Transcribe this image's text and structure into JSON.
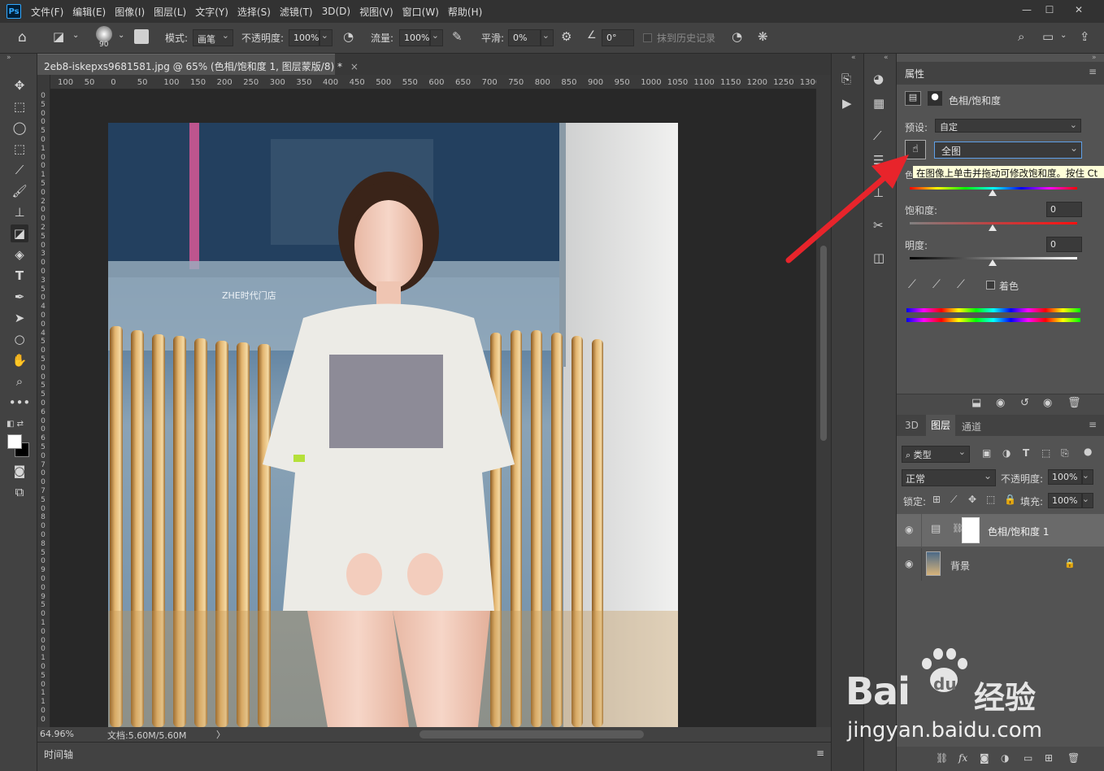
{
  "menubar": {
    "logo": "Ps",
    "items": [
      "文件(F)",
      "编辑(E)",
      "图像(I)",
      "图层(L)",
      "文字(Y)",
      "选择(S)",
      "滤镜(T)",
      "3D(D)",
      "视图(V)",
      "窗口(W)",
      "帮助(H)"
    ],
    "window_controls": [
      "—",
      "☐",
      "✕"
    ]
  },
  "options_bar": {
    "brush_size": "90",
    "mode_label": "模式:",
    "mode_value": "画笔",
    "opacity_label": "不透明度:",
    "opacity_value": "100%",
    "flow_label": "流量:",
    "flow_value": "100%",
    "smooth_label": "平滑:",
    "smooth_value": "0%",
    "angle_value": "0°",
    "erase_history_label": "抹到历史记录"
  },
  "document": {
    "tab_title": "2eb8-iskepxs9681581.jpg @ 65% (色相/饱和度 1, 图层蒙版/8) *",
    "close_glyph": "×",
    "ruler_h": [
      "100",
      "50",
      "0",
      "50",
      "100",
      "150",
      "200",
      "250",
      "300",
      "350",
      "400",
      "450",
      "500",
      "550",
      "600",
      "650",
      "700",
      "750",
      "800",
      "850",
      "900",
      "950",
      "1000",
      "1050",
      "1100",
      "1150",
      "1200",
      "1250",
      "1300"
    ],
    "ruler_v": [
      "0",
      "5",
      "0",
      "0",
      "5",
      "0",
      "1",
      "0",
      "0",
      "1",
      "5",
      "0",
      "2",
      "0",
      "0",
      "2",
      "5",
      "0",
      "3",
      "0",
      "0",
      "3",
      "5",
      "0",
      "4",
      "0",
      "0",
      "4",
      "5",
      "0",
      "5",
      "0",
      "0",
      "5",
      "5",
      "0",
      "6",
      "0",
      "0",
      "6",
      "5",
      "0",
      "7",
      "0",
      "0",
      "7",
      "5",
      "0",
      "8",
      "0",
      "0",
      "8",
      "5",
      "0",
      "9",
      "0",
      "0",
      "9",
      "5",
      "0",
      "1",
      "0",
      "0",
      "0",
      "1",
      "0",
      "5",
      "0",
      "1",
      "1",
      "0",
      "0"
    ],
    "photo_text": "ZHE时代门店"
  },
  "status": {
    "zoom": "64.96%",
    "doc_size": "文档:5.60M/5.60M",
    "arrow": "〉"
  },
  "timeline": {
    "label": "时间轴"
  },
  "properties": {
    "title": "属性",
    "adjustment_name": "色相/饱和度",
    "preset_label": "预设:",
    "preset_value": "自定",
    "range_value": "全图",
    "tooltip": "在图像上单击并拖动可修改饱和度。按住 Ct",
    "hue_label_partial": "色",
    "saturation_label": "饱和度:",
    "saturation_value": "0",
    "lightness_label": "明度:",
    "lightness_value": "0",
    "colorize_label": "着色"
  },
  "layers_panel": {
    "tabs": [
      "3D",
      "图层",
      "通道"
    ],
    "filter_value": "类型",
    "blend_value": "正常",
    "opacity_label": "不透明度:",
    "opacity_value": "100%",
    "lock_label": "锁定:",
    "fill_label": "填充:",
    "fill_value": "100%",
    "layers": [
      {
        "name": "色相/饱和度 1"
      },
      {
        "name": "背景"
      }
    ],
    "bottom_fx": "fx"
  },
  "watermark": {
    "brand": "Bai",
    "brand2": "du",
    "brand_cn": "经验",
    "url": "jingyan.baidu.com"
  },
  "colors": {
    "panel": "#535353",
    "dark": "#424242",
    "menubar": "#323232",
    "arrow_red": "#e8242b",
    "tooltip_bg": "#fdfdd8"
  }
}
